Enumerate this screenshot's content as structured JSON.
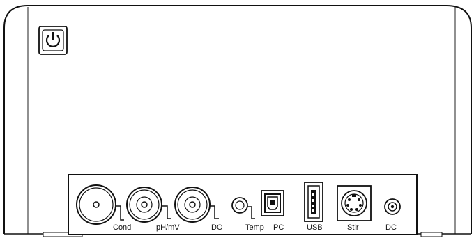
{
  "device": {
    "power_button_icon": "power-icon",
    "ports": [
      {
        "id": "cond",
        "label": "Cond",
        "connector": "bnc"
      },
      {
        "id": "phmv",
        "label": "pH/mV",
        "connector": "bnc"
      },
      {
        "id": "do",
        "label": "DO",
        "connector": "bnc"
      },
      {
        "id": "temp",
        "label": "Temp",
        "connector": "rca"
      },
      {
        "id": "pc",
        "label": "PC",
        "connector": "usb-b"
      },
      {
        "id": "usb",
        "label": "USB",
        "connector": "usb-a"
      },
      {
        "id": "stir",
        "label": "Stir",
        "connector": "mini-din"
      },
      {
        "id": "dc",
        "label": "DC",
        "connector": "dc-jack"
      }
    ]
  }
}
